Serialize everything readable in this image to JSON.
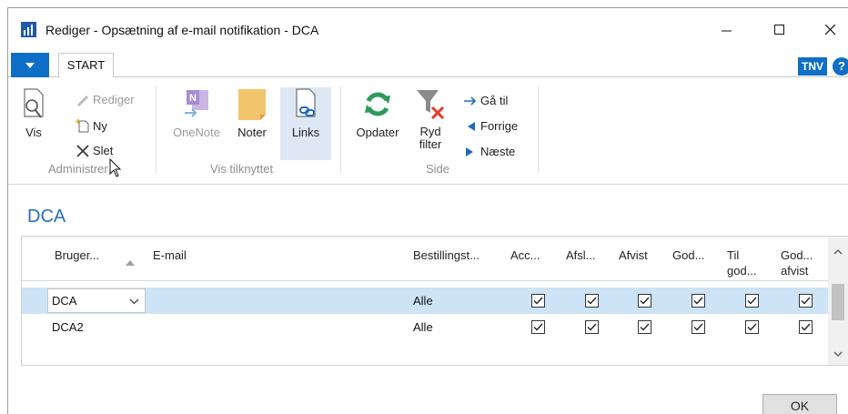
{
  "window": {
    "title": "Rediger - Opsætning af e-mail notifikation - DCA",
    "app_icon": "chart-logo-icon"
  },
  "tabs": {
    "menu_icon": "dropdown-triangle-icon",
    "start_label": "START",
    "user_badge": "TNV",
    "help_label": "?"
  },
  "ribbon": {
    "groups": {
      "administrer": "Administrer",
      "vis_tilknyttet": "Vis tilknyttet",
      "side": "Side"
    },
    "buttons": {
      "vis": "Vis",
      "rediger": "Rediger",
      "ny": "Ny",
      "slet": "Slet",
      "onenote": "OneNote",
      "noter": "Noter",
      "links": "Links",
      "opdater": "Opdater",
      "ryd_filter_1": "Ryd",
      "ryd_filter_2": "filter",
      "ga_til": "Gå til",
      "forrige": "Forrige",
      "naeste": "Næste"
    }
  },
  "page": {
    "title": "DCA"
  },
  "grid": {
    "columns": {
      "bruger": "Bruger...",
      "email": "E-mail",
      "bestilling": "Bestillingst...",
      "acc": "Acc...",
      "afsl": "Afsl...",
      "afvist": "Afvist",
      "god": "God...",
      "til_god_1": "Til",
      "til_god_2": "god...",
      "god_afvist_1": "God...",
      "god_afvist_2": "afvist"
    },
    "rows": [
      {
        "bruger": "DCA",
        "email": "",
        "bestilling": "Alle",
        "checks": [
          true,
          true,
          true,
          true,
          true,
          true
        ]
      },
      {
        "bruger": "DCA2",
        "email": "",
        "bestilling": "Alle",
        "checks": [
          true,
          true,
          true,
          true,
          true,
          true
        ]
      }
    ]
  },
  "footer": {
    "ok_label": "OK"
  }
}
